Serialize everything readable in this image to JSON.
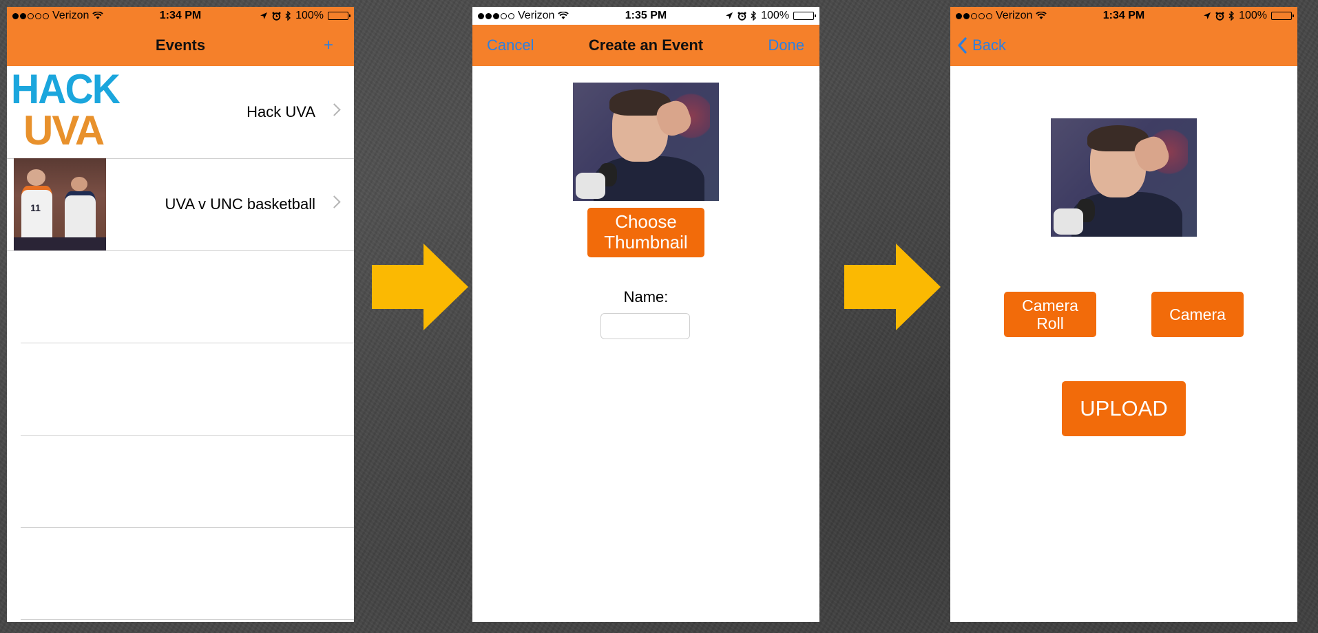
{
  "status_bars": [
    {
      "carrier": "Verizon",
      "time": "1:34 PM",
      "battery": "100%",
      "battery_level": 1.0
    },
    {
      "carrier": "Verizon",
      "time": "1:35 PM",
      "battery": "100%",
      "battery_level": 1.0
    },
    {
      "carrier": "Verizon",
      "time": "1:34 PM",
      "battery": "100%",
      "battery_level": 1.0
    }
  ],
  "screen1": {
    "title": "Events",
    "add_label": "+",
    "events": [
      {
        "label": "Hack UVA",
        "logo_top": "HACK",
        "logo_bottom": "UVA"
      },
      {
        "label": "UVA v UNC basketball"
      }
    ]
  },
  "screen2": {
    "cancel": "Cancel",
    "title": "Create an Event",
    "done": "Done",
    "choose_line1": "Choose",
    "choose_line2": "Thumbnail",
    "name_label": "Name:",
    "name_value": ""
  },
  "screen3": {
    "back": "Back",
    "camera_roll_line1": "Camera",
    "camera_roll_line2": "Roll",
    "camera": "Camera",
    "upload": "UPLOAD"
  },
  "colors": {
    "accent_orange": "#f5802a",
    "button_orange": "#f26b0a",
    "link_blue": "#2d7fe0",
    "arrow_yellow": "#fbb902"
  }
}
